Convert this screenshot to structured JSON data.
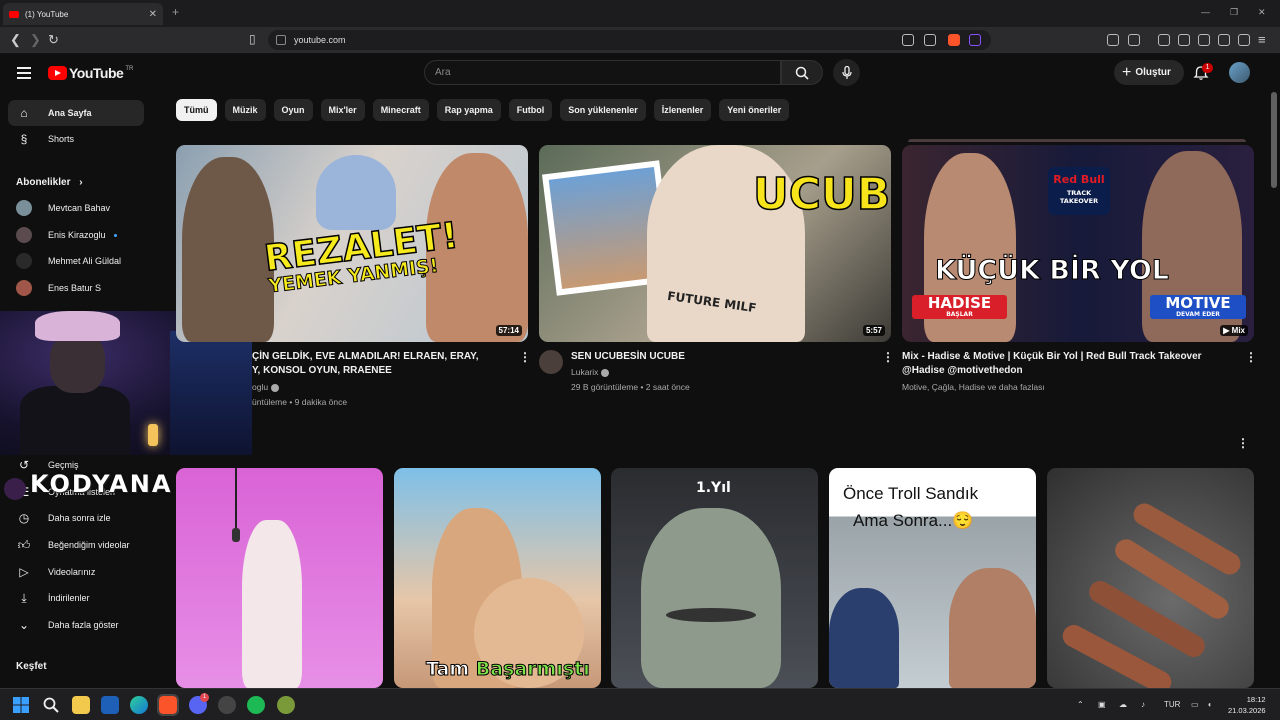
{
  "browser": {
    "tab_title": "(1) YouTube",
    "new_tab": "+",
    "url": "youtube.com",
    "window_controls": [
      "—",
      "❐",
      "✕"
    ]
  },
  "header": {
    "logo_text": "YouTube",
    "country_code": "TR",
    "search_placeholder": "Ara",
    "create_label": "Oluştur",
    "notification_count": "1"
  },
  "sidebar": {
    "primary": [
      {
        "label": "Ana Sayfa",
        "icon": "home-icon"
      },
      {
        "label": "Shorts",
        "icon": "shorts-icon"
      }
    ],
    "subscriptions_heading": "Abonelikler",
    "subscriptions": [
      {
        "label": "Mevtcan Bahav",
        "color": "#7a8f9a"
      },
      {
        "label": "Enis Kirazoglu",
        "color": "#5b4b4f",
        "live": true
      },
      {
        "label": "Mehmet Ali Güldal",
        "color": "#2a2a2a"
      },
      {
        "label": "Enes Batur S",
        "color": "#a0574a"
      }
    ],
    "you_items": [
      {
        "label": "Geçmiş",
        "icon": "history-icon"
      },
      {
        "label": "Oynatma listeleri",
        "icon": "playlist-icon"
      },
      {
        "label": "Daha sonra izle",
        "icon": "watch-later-icon"
      },
      {
        "label": "Beğendiğim videolar",
        "icon": "like-icon"
      },
      {
        "label": "Videolarınız",
        "icon": "your-videos-icon"
      },
      {
        "label": "İndirilenler",
        "icon": "download-icon"
      },
      {
        "label": "Daha fazla göster",
        "icon": "chevron-down-icon"
      }
    ],
    "explore_heading": "Keşfet",
    "overlay_logo": "KODYANA"
  },
  "chips": [
    "Tümü",
    "Müzik",
    "Oyun",
    "Mix'ler",
    "Minecraft",
    "Rap yapma",
    "Futbol",
    "Son yüklenenler",
    "İzlenenler",
    "Yeni öneriler"
  ],
  "videos": [
    {
      "title_line1": "ÇİN GELDİK, EVE ALMADILAR! ELRAEN, ERAY,",
      "title_line2": "Y, KONSOL OYUN, RRAENEE",
      "channel": "oglu",
      "meta": "üntüleme • 9 dakika önce",
      "duration": "57:14",
      "thumb_text_1": "REZALET!",
      "thumb_text_2": "YEMEK YANMIŞ!"
    },
    {
      "title_line1": "SEN UCUBESİN UCUBE",
      "title_line2": "",
      "channel": "Lukarix",
      "meta": "29 B görüntüleme • 2 saat önce",
      "duration": "5:57",
      "thumb_text_1": "UCUBE",
      "thumb_shirt": "FUTURE MILF"
    },
    {
      "title_line1": "Mix - Hadise & Motive | Küçük Bir Yol | Red Bull Track Takeover",
      "title_line2": "@Hadise @motivethedon",
      "channel": "Motive, Çağla, Hadise ve daha fazlası",
      "meta": "",
      "duration": "Mix",
      "thumb_text_1": "KÜÇÜK BİR YOL",
      "thumb_left": "HADISE",
      "thumb_left_sub": "BAŞLAR",
      "thumb_right": "MOTIVE",
      "thumb_right_sub": "DEVAM EDER",
      "thumb_badge_1": "Red Bull",
      "thumb_badge_2": "TRACK TAKEOVER"
    }
  ],
  "shorts": [
    {
      "overlay": ""
    },
    {
      "overlay_1": "Tam ",
      "overlay_2": "Başarmıştı"
    },
    {
      "overlay": "1.Yıl"
    },
    {
      "overlay_1": "Önce Troll Sandık",
      "overlay_2": "Ama Sonra...😌"
    },
    {
      "overlay": ""
    }
  ],
  "taskbar": {
    "language": "TUR",
    "time": "18:12",
    "date": "21.03.2026",
    "discord_badge": "1"
  },
  "colors": {
    "yt_red": "#ff0000",
    "background": "#0f0f0f",
    "chip_bg": "#272727"
  }
}
